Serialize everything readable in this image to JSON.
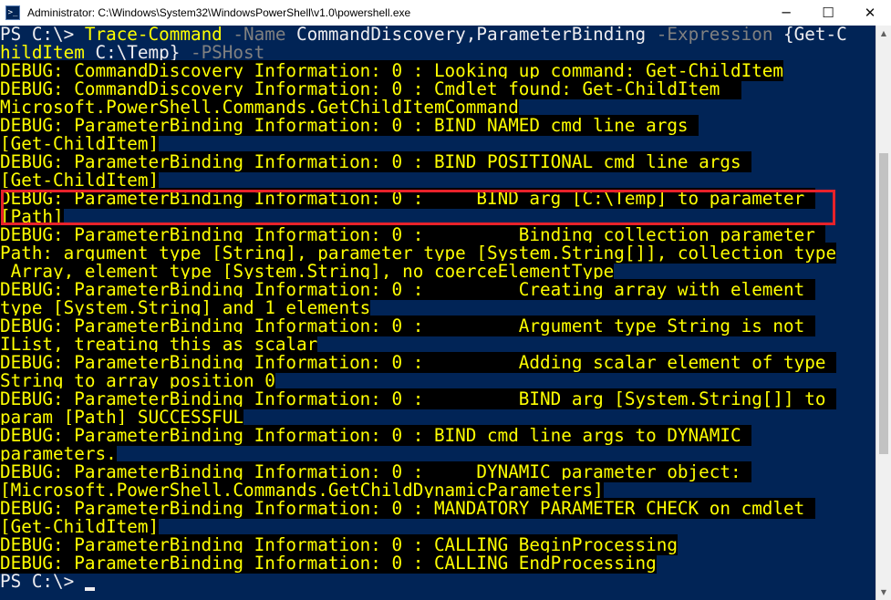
{
  "window": {
    "title": "Administrator: C:\\Windows\\System32\\WindowsPowerShell\\v1.0\\powershell.exe",
    "icon": "powershell-icon",
    "controls": {
      "minimize": "─",
      "maximize": "☐",
      "close": "✕"
    }
  },
  "colors": {
    "background": "#012456",
    "debug_fg": "#ffff00",
    "debug_bg": "#000000",
    "highlight": "#e8222a"
  },
  "command": {
    "prompt": "PS C:\\> ",
    "cmdlet": "Trace-Command",
    "p1": " -Name",
    "a1": " CommandDiscovery,ParameterBinding",
    "p2": " -Expression",
    "a2": " {Get-C",
    "wrap_cmd": "hildItem",
    "wrap_arg": " C:\\Temp}",
    "p3": " -PSHost"
  },
  "debug_lines": [
    "DEBUG: CommandDiscovery Information: 0 : Looking up command: Get-ChildItem",
    "DEBUG: CommandDiscovery Information: 0 : Cmdlet found: Get-ChildItem  ",
    "Microsoft.PowerShell.Commands.GetChildItemCommand",
    "DEBUG: ParameterBinding Information: 0 : BIND NAMED cmd line args ",
    "[Get-ChildItem]",
    "DEBUG: ParameterBinding Information: 0 : BIND POSITIONAL cmd line args ",
    "[Get-ChildItem]",
    "DEBUG: ParameterBinding Information: 0 :     BIND arg [C:\\Temp] to parameter ",
    "[Path]",
    "DEBUG: ParameterBinding Information: 0 :         Binding collection parameter ",
    "Path: argument type [String], parameter type [System.String[]], collection type",
    " Array, element type [System.String], no coerceElementType",
    "DEBUG: ParameterBinding Information: 0 :         Creating array with element ",
    "type [System.String] and 1 elements",
    "DEBUG: ParameterBinding Information: 0 :         Argument type String is not ",
    "IList, treating this as scalar",
    "DEBUG: ParameterBinding Information: 0 :         Adding scalar element of type ",
    "String to array position 0",
    "DEBUG: ParameterBinding Information: 0 :         BIND arg [System.String[]] to ",
    "param [Path] SUCCESSFUL",
    "DEBUG: ParameterBinding Information: 0 : BIND cmd line args to DYNAMIC ",
    "parameters.",
    "DEBUG: ParameterBinding Information: 0 :     DYNAMIC parameter object: ",
    "[Microsoft.PowerShell.Commands.GetChildDynamicParameters]",
    "DEBUG: ParameterBinding Information: 0 : MANDATORY PARAMETER CHECK on cmdlet ",
    "[Get-ChildItem]",
    "DEBUG: ParameterBinding Information: 0 : CALLING BeginProcessing",
    "DEBUG: ParameterBinding Information: 0 : CALLING EndProcessing"
  ],
  "final_prompt": "PS C:\\> "
}
